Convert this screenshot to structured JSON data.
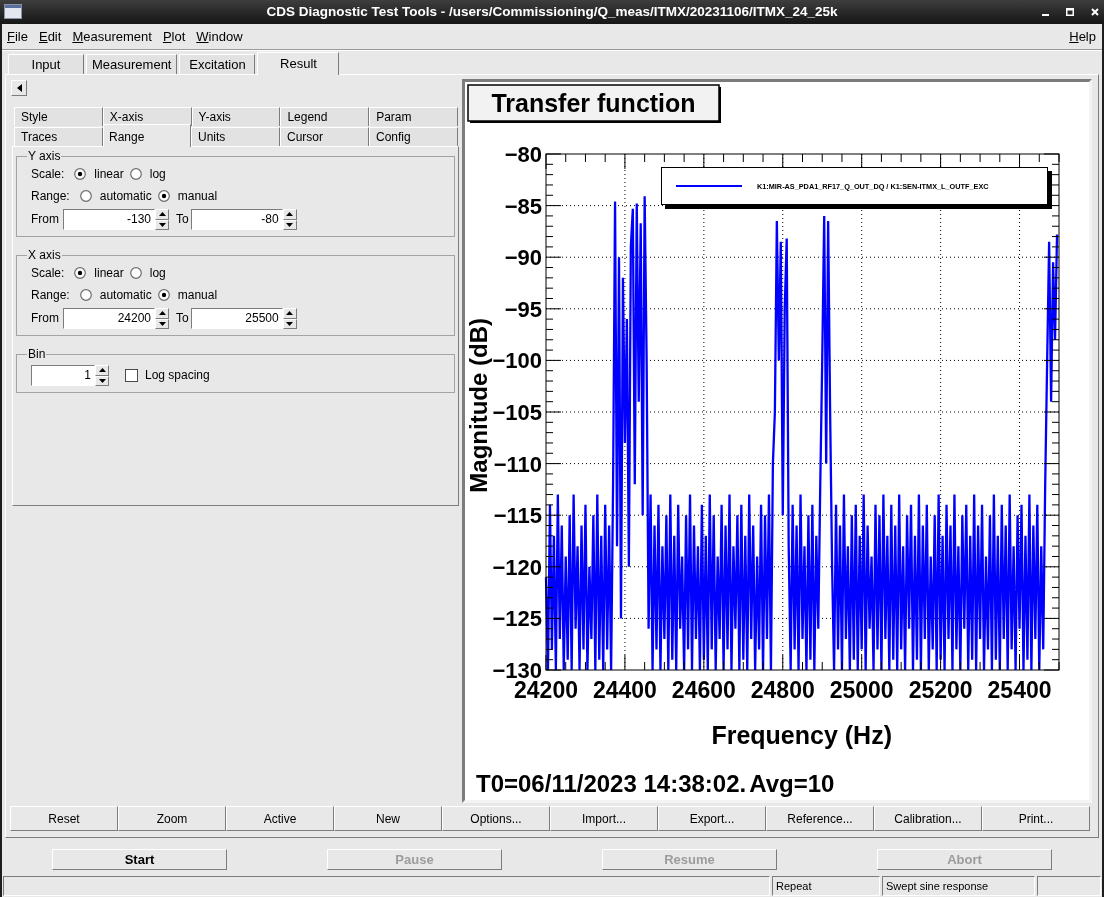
{
  "window": {
    "title": "CDS Diagnostic Test Tools - /users/Commissioning/Q_meas/ITMX/20231106/ITMX_24_25k"
  },
  "menu_bar": {
    "menus": [
      "File",
      "Edit",
      "Measurement",
      "Plot",
      "Window"
    ],
    "help": "Help"
  },
  "tabs": [
    {
      "label": "Input",
      "selected": false
    },
    {
      "label": "Measurement",
      "selected": false
    },
    {
      "label": "Excitation",
      "selected": false
    },
    {
      "label": "Result",
      "selected": true
    }
  ],
  "options_panel": {
    "tab_rows": [
      {
        "tabs": [
          {
            "label": "Style",
            "selected": false
          },
          {
            "label": "X-axis",
            "selected": false
          },
          {
            "label": "Y-axis",
            "selected": false
          },
          {
            "label": "Legend",
            "selected": false
          },
          {
            "label": "Param",
            "selected": false
          }
        ]
      },
      {
        "tabs": [
          {
            "label": "Traces",
            "selected": false
          },
          {
            "label": "Range",
            "selected": true
          },
          {
            "label": "Units",
            "selected": false
          },
          {
            "label": "Cursor",
            "selected": false
          },
          {
            "label": "Config",
            "selected": false
          }
        ]
      }
    ],
    "groups": [
      {
        "title": "Y axis",
        "rows": [
          {
            "kind": "radio",
            "label": "Scale:",
            "options": [
              {
                "label": "linear",
                "selected": true
              },
              {
                "label": "log",
                "selected": false
              }
            ]
          },
          {
            "kind": "radio",
            "label": "Range:",
            "options": [
              {
                "label": "automatic",
                "selected": false
              },
              {
                "label": "manual",
                "selected": true
              }
            ]
          },
          {
            "kind": "range",
            "fields": [
              {
                "label": "From",
                "value": "-130"
              },
              {
                "label": "To",
                "value": "-80"
              }
            ]
          }
        ]
      },
      {
        "title": "X axis",
        "rows": [
          {
            "kind": "radio",
            "label": "Scale:",
            "options": [
              {
                "label": "linear",
                "selected": true
              },
              {
                "label": "log",
                "selected": false
              }
            ]
          },
          {
            "kind": "radio",
            "label": "Range:",
            "options": [
              {
                "label": "automatic",
                "selected": false
              },
              {
                "label": "manual",
                "selected": true
              }
            ]
          },
          {
            "kind": "range",
            "fields": [
              {
                "label": "From",
                "value": "24200"
              },
              {
                "label": "To",
                "value": "25500"
              }
            ]
          }
        ]
      },
      {
        "title": "Bin",
        "rows": [
          {
            "kind": "bin",
            "value": "1",
            "checkbox": {
              "label": "Log spacing",
              "checked": false
            }
          }
        ]
      }
    ]
  },
  "plot": {
    "chart_data": {
      "type": "line",
      "title": "Transfer function",
      "xlabel": "Frequency (Hz)",
      "ylabel": "Magnitude (dB)",
      "grid": true,
      "x": [
        24200,
        24205,
        24210,
        24215,
        24220,
        24225,
        24230,
        24235,
        24240,
        24245,
        24250,
        24255,
        24260,
        24265,
        24270,
        24275,
        24280,
        24285,
        24290,
        24295,
        24300,
        24305,
        24310,
        24315,
        24320,
        24325,
        24330,
        24335,
        24340,
        24345,
        24350,
        24355,
        24360,
        24365,
        24370,
        24375,
        24380,
        24385,
        24390,
        24395,
        24400,
        24405,
        24410,
        24415,
        24420,
        24425,
        24430,
        24435,
        24440,
        24445,
        24450,
        24455,
        24460,
        24465,
        24470,
        24475,
        24480,
        24485,
        24490,
        24495,
        24500,
        24505,
        24510,
        24515,
        24520,
        24525,
        24530,
        24535,
        24540,
        24545,
        24550,
        24555,
        24560,
        24565,
        24570,
        24575,
        24580,
        24585,
        24590,
        24595,
        24600,
        24605,
        24610,
        24615,
        24620,
        24625,
        24630,
        24635,
        24640,
        24645,
        24650,
        24655,
        24660,
        24665,
        24670,
        24675,
        24680,
        24685,
        24690,
        24695,
        24700,
        24705,
        24710,
        24715,
        24720,
        24725,
        24730,
        24735,
        24740,
        24745,
        24750,
        24755,
        24760,
        24765,
        24770,
        24775,
        24780,
        24785,
        24790,
        24795,
        24800,
        24805,
        24810,
        24815,
        24820,
        24825,
        24830,
        24835,
        24840,
        24845,
        24850,
        24855,
        24860,
        24865,
        24870,
        24875,
        24880,
        24885,
        24890,
        24895,
        24900,
        24905,
        24910,
        24915,
        24920,
        24925,
        24930,
        24935,
        24940,
        24945,
        24950,
        24955,
        24960,
        24965,
        24970,
        24975,
        24980,
        24985,
        24990,
        24995,
        25000,
        25005,
        25010,
        25015,
        25020,
        25025,
        25030,
        25035,
        25040,
        25045,
        25050,
        25055,
        25060,
        25065,
        25070,
        25075,
        25080,
        25085,
        25090,
        25095,
        25100,
        25105,
        25110,
        25115,
        25120,
        25125,
        25130,
        25135,
        25140,
        25145,
        25150,
        25155,
        25160,
        25165,
        25170,
        25175,
        25180,
        25185,
        25190,
        25195,
        25200,
        25205,
        25210,
        25215,
        25220,
        25225,
        25230,
        25235,
        25240,
        25245,
        25250,
        25255,
        25260,
        25265,
        25270,
        25275,
        25280,
        25285,
        25290,
        25295,
        25300,
        25305,
        25310,
        25315,
        25320,
        25325,
        25330,
        25335,
        25340,
        25345,
        25350,
        25355,
        25360,
        25365,
        25370,
        25375,
        25380,
        25385,
        25390,
        25395,
        25400,
        25405,
        25410,
        25415,
        25420,
        25425,
        25430,
        25435,
        25440,
        25445,
        25450,
        25455,
        25460,
        25465,
        25470,
        25475,
        25480,
        25485,
        25490,
        25495
      ],
      "series": [
        {
          "name": "K1:MIR-AS_PDA1_RF17_Q_OUT_DQ / K1:SEN-ITMX_L_OUTF_EXC",
          "color": "#0000ff",
          "values": [
            -121,
            -130,
            -114,
            -128,
            -117,
            -130,
            -113,
            -127,
            -116,
            -130,
            -119,
            -129,
            -115,
            -130,
            -113,
            -126,
            -118,
            -130,
            -116,
            -128,
            -114,
            -130,
            -120,
            -127,
            -115,
            -130,
            -113,
            -129,
            -117,
            -130,
            -114,
            -128,
            -116,
            -130,
            -112,
            -84.6,
            -118,
            -90,
            -125,
            -92,
            -108,
            -96,
            -120,
            -89,
            -85.3,
            -112,
            -84.8,
            -104,
            -86.7,
            -115,
            -84.1,
            -100,
            -126,
            -113,
            -130,
            -116,
            -128,
            -114,
            -130,
            -118,
            -127,
            -115,
            -130,
            -113,
            -129,
            -117,
            -130,
            -114,
            -126,
            -119,
            -130,
            -115,
            -128,
            -113,
            -130,
            -116,
            -127,
            -118,
            -130,
            -114,
            -129,
            -117,
            -130,
            -113,
            -128,
            -115,
            -130,
            -119,
            -127,
            -114,
            -130,
            -116,
            -128,
            -113,
            -130,
            -118,
            -126,
            -115,
            -130,
            -114,
            -129,
            -117,
            -130,
            -113,
            -127,
            -116,
            -130,
            -119,
            -128,
            -114,
            -130,
            -115,
            -127,
            -113,
            -130,
            -110,
            -105,
            -86.5,
            -100,
            -88.5,
            -115,
            -95,
            -88.2,
            -118,
            -130,
            -114,
            -128,
            -116,
            -130,
            -113,
            -127,
            -118,
            -130,
            -115,
            -129,
            -114,
            -130,
            -117,
            -126,
            -112,
            -100,
            -86,
            -110,
            -86.5,
            -105,
            -120,
            -130,
            -114,
            -128,
            -116,
            -130,
            -113,
            -127,
            -118,
            -130,
            -115,
            -129,
            -114,
            -130,
            -117,
            -128,
            -113,
            -130,
            -116,
            -126,
            -119,
            -130,
            -114,
            -128,
            -115,
            -130,
            -113,
            -127,
            -117,
            -130,
            -114,
            -129,
            -116,
            -130,
            -113,
            -128,
            -118,
            -130,
            -115,
            -126,
            -114,
            -130,
            -117,
            -129,
            -113,
            -130,
            -116,
            -127,
            -114,
            -130,
            -119,
            -128,
            -115,
            -130,
            -113,
            -129,
            -117,
            -130,
            -114,
            -127,
            -116,
            -130,
            -113,
            -128,
            -118,
            -130,
            -115,
            -126,
            -114,
            -130,
            -117,
            -129,
            -113,
            -130,
            -116,
            -127,
            -114,
            -130,
            -119,
            -128,
            -115,
            -130,
            -113,
            -129,
            -117,
            -130,
            -114,
            -127,
            -116,
            -130,
            -113,
            -128,
            -118,
            -130,
            -115,
            -126,
            -114,
            -130,
            -117,
            -129,
            -113,
            -130,
            -116,
            -127,
            -114,
            -130,
            -118,
            -128,
            -112,
            -100,
            -88.5,
            -104,
            -90.5,
            -98,
            -87.8
          ]
        }
      ],
      "xlim": [
        24200,
        25500
      ],
      "ylim": [
        -130,
        -80
      ],
      "xticks": [
        24200,
        24400,
        24600,
        24800,
        25000,
        25200,
        25400
      ],
      "yticks": [
        {
          "value": -130,
          "label": "−130"
        },
        {
          "value": -125,
          "label": "−125"
        },
        {
          "value": -120,
          "label": "−120"
        },
        {
          "value": -115,
          "label": "−115"
        },
        {
          "value": -110,
          "label": "−110"
        },
        {
          "value": -105,
          "label": "−105"
        },
        {
          "value": -100,
          "label": "−100"
        },
        {
          "value": -95,
          "label": "−95"
        },
        {
          "value": -90,
          "label": "−90"
        },
        {
          "value": -85,
          "label": "−85"
        },
        {
          "value": -80,
          "label": "−80"
        }
      ]
    },
    "timestamp": "T0=06/11/2023 14:38:02.",
    "average": "Avg=10"
  },
  "plot_buttons": [
    "Reset",
    "Zoom",
    "Active",
    "New",
    "Options...",
    "Import...",
    "Export...",
    "Reference...",
    "Calibration...",
    "Print..."
  ],
  "run_buttons": [
    {
      "label": "Start",
      "disabled": false
    },
    {
      "label": "Pause",
      "disabled": true
    },
    {
      "label": "Resume",
      "disabled": true
    },
    {
      "label": "Abort",
      "disabled": true
    }
  ],
  "status_bar": [
    "Repeat",
    "Swept sine response"
  ]
}
